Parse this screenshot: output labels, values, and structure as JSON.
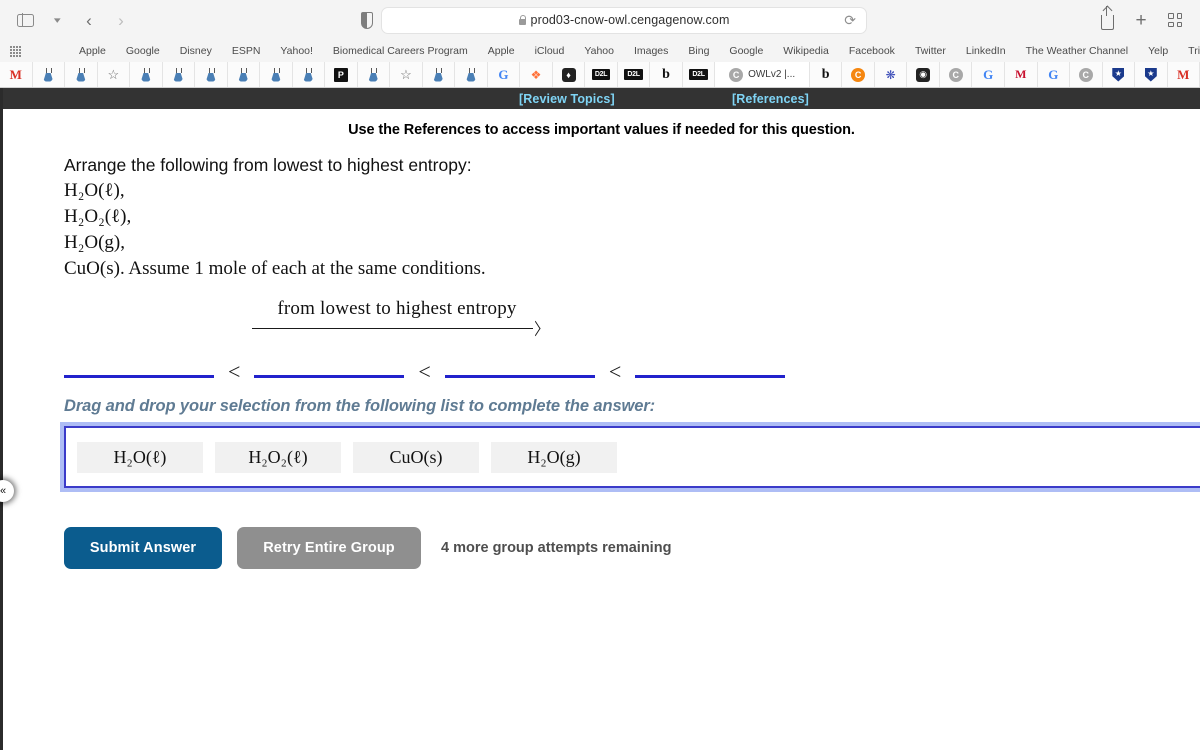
{
  "browser": {
    "url": "prod03-cnow-owl.cengagenow.com",
    "lock_icon": "lock-icon",
    "sidebar_icon": "sidebar-toggle-icon",
    "back_icon": "back-arrow-icon",
    "forward_icon": "forward-arrow-icon",
    "shield_icon": "privacy-shield-icon",
    "reload_icon": "reload-icon",
    "share_icon": "share-icon",
    "new_tab_icon": "plus-icon",
    "tabs_overview_icon": "tab-overview-icon",
    "bookmarks_grid_icon": "bookmarks-grid-icon",
    "favorites": [
      "Apple",
      "Google",
      "Disney",
      "ESPN",
      "Yahoo!",
      "Biomedical Careers Program",
      "Apple",
      "iCloud",
      "Yahoo",
      "Images",
      "Bing",
      "Google",
      "Wikipedia",
      "Facebook",
      "Twitter",
      "LinkedIn",
      "The Weather Channel",
      "Yelp",
      "TripAdvisor"
    ],
    "tab_title": "OWLv2 |..."
  },
  "topbar": {
    "review_topics": "[Review Topics]",
    "references": "[References]"
  },
  "question": {
    "reference_note": "Use the References to access important values if needed for this question.",
    "prompt": "Arrange the following from lowest to highest entropy:",
    "species": [
      "H₂O(ℓ),",
      "H₂O₂(ℓ),",
      "H₂O(g),",
      "CuO(s). Assume 1 mole of each at the same conditions."
    ],
    "arrow_label": "from lowest to highest entropy",
    "comparator": "<",
    "slot_count": 4,
    "slot_color": "#2222cc"
  },
  "dragdrop": {
    "instruction": "Drag and drop your selection from the following list to complete the answer:",
    "tiles": [
      "H₂O(ℓ)",
      "H₂O₂(ℓ)",
      "CuO(s)",
      "H₂O(g)"
    ],
    "border_color": "#3b3bc9"
  },
  "actions": {
    "submit_label": "Submit Answer",
    "retry_label": "Retry Entire Group",
    "attempts_text": "4 more group attempts remaining",
    "submit_color": "#0b5c8e",
    "retry_color": "#8f8f8f"
  },
  "collapse_handle": {
    "glyph": "«"
  }
}
